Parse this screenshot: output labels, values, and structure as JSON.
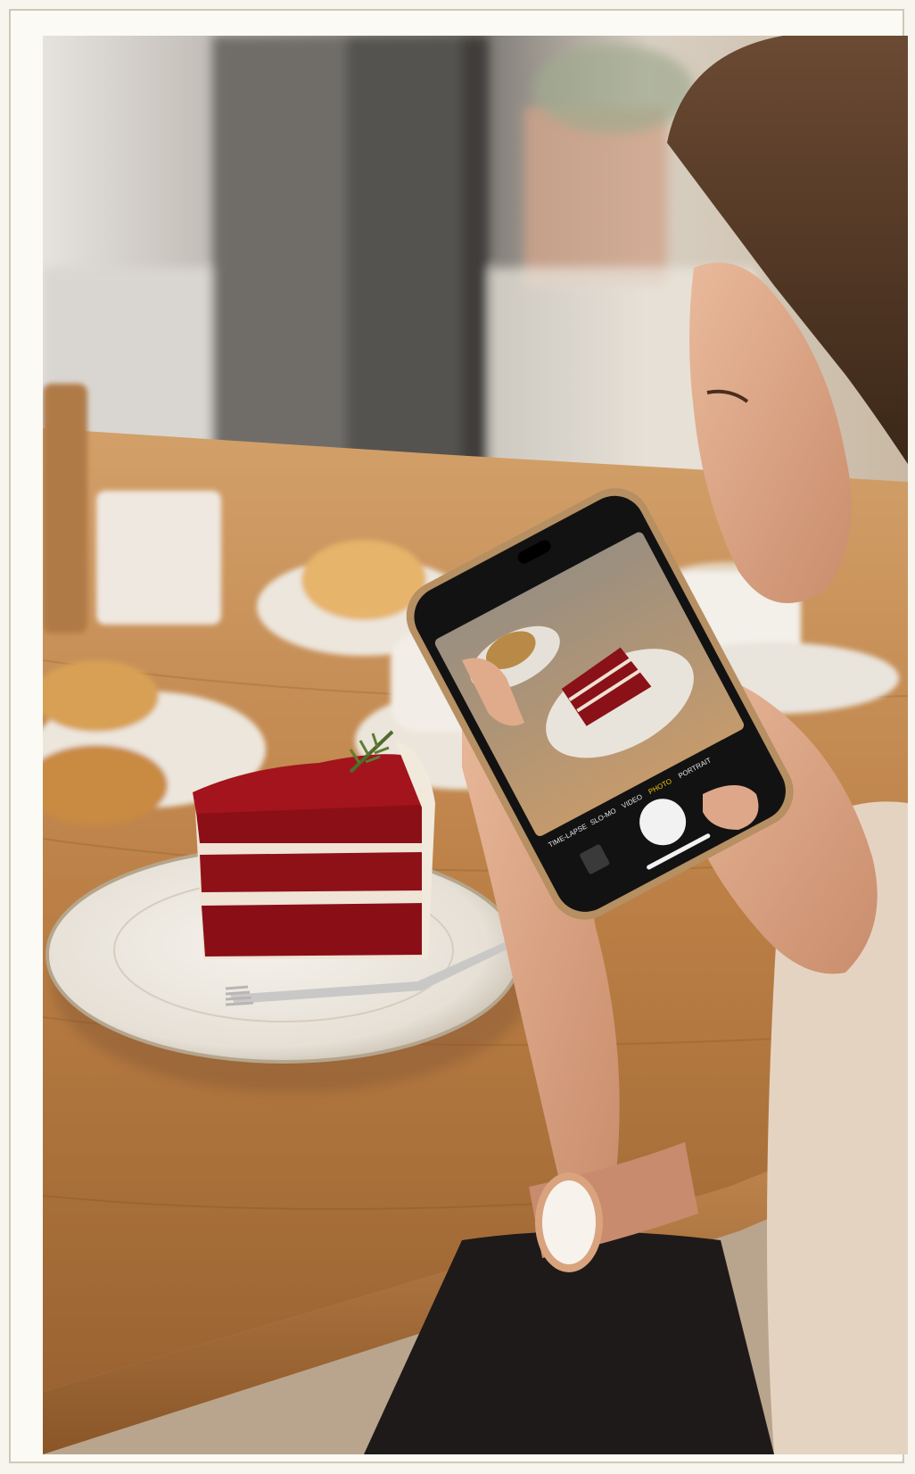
{
  "image": {
    "description_colors": {
      "frame_bg": "#fbfaf4",
      "frame_border": "#c9cbb8",
      "table_wood": "#b97b44",
      "cake_red": "#8e0f16",
      "frosting": "#efe6d9",
      "plate": "#ece7df",
      "phone_body": "#b68f63",
      "watch_gold": "#c98b6d"
    },
    "phone_screen": {
      "mode_labels": [
        "TIME-LAPSE",
        "SLO-MO",
        "VIDEO",
        "PHOTO",
        "PORTRAIT"
      ],
      "active_mode": "PHOTO"
    }
  }
}
